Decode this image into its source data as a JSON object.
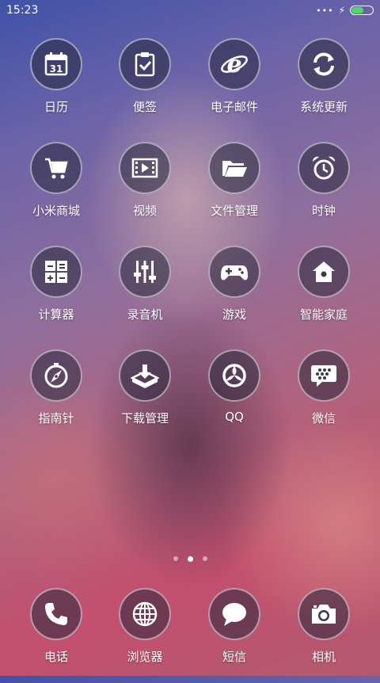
{
  "status": {
    "time": "15:23",
    "more": "•••",
    "charging": "⚡"
  },
  "apps": [
    {
      "label": "日历",
      "icon": "calendar-icon",
      "day": "31"
    },
    {
      "label": "便签",
      "icon": "notes-icon"
    },
    {
      "label": "电子邮件",
      "icon": "email-icon"
    },
    {
      "label": "系统更新",
      "icon": "update-icon"
    },
    {
      "label": "小米商城",
      "icon": "cart-icon"
    },
    {
      "label": "视频",
      "icon": "video-icon"
    },
    {
      "label": "文件管理",
      "icon": "folder-icon"
    },
    {
      "label": "时钟",
      "icon": "alarm-clock-icon"
    },
    {
      "label": "计算器",
      "icon": "calculator-icon"
    },
    {
      "label": "录音机",
      "icon": "recorder-icon"
    },
    {
      "label": "游戏",
      "icon": "gamepad-icon"
    },
    {
      "label": "智能家庭",
      "icon": "home-icon"
    },
    {
      "label": "指南针",
      "icon": "compass-icon"
    },
    {
      "label": "下载管理",
      "icon": "download-icon"
    },
    {
      "label": "QQ",
      "icon": "qq-icon"
    },
    {
      "label": "微信",
      "icon": "wechat-icon"
    }
  ],
  "dock": [
    {
      "label": "电话",
      "icon": "phone-icon"
    },
    {
      "label": "浏览器",
      "icon": "globe-icon"
    },
    {
      "label": "短信",
      "icon": "message-icon"
    },
    {
      "label": "相机",
      "icon": "camera-icon"
    }
  ],
  "pager": {
    "pages": 3,
    "active": 2
  },
  "colors": {
    "icon_bg": "#282838",
    "battery": "#4cd964"
  }
}
